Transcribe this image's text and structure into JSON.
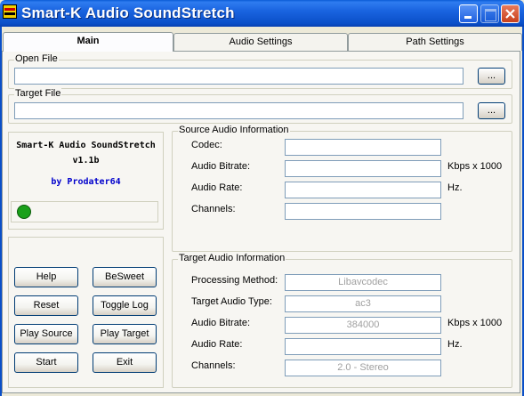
{
  "window": {
    "title": "Smart-K Audio SoundStretch"
  },
  "tabs": [
    {
      "label": "Main"
    },
    {
      "label": "Audio Settings"
    },
    {
      "label": "Path Settings"
    }
  ],
  "open_file": {
    "legend": "Open File",
    "value": "",
    "browse_label": "..."
  },
  "target_file": {
    "legend": "Target File",
    "value": "",
    "browse_label": "..."
  },
  "about": {
    "app_name": "Smart-K Audio SoundStretch",
    "version": "v1.1b",
    "author": "by Prodater64",
    "author_color": "#0000cc",
    "status_color": "#1aa01a"
  },
  "buttons": {
    "help": "Help",
    "besweet": "BeSweet",
    "reset": "Reset",
    "toggle_log": "Toggle Log",
    "play_source": "Play Source",
    "play_target": "Play Target",
    "start": "Start",
    "exit": "Exit"
  },
  "source_info": {
    "legend": "Source Audio Information",
    "codec_label": "Codec:",
    "codec_value": "",
    "bitrate_label": "Audio Bitrate:",
    "bitrate_value": "",
    "bitrate_unit": "Kbps x 1000",
    "rate_label": "Audio Rate:",
    "rate_value": "",
    "rate_unit": "Hz.",
    "channels_label": "Channels:",
    "channels_value": ""
  },
  "target_info": {
    "legend": "Target Audio Information",
    "method_label": "Processing Method:",
    "method_value": "Libavcodec",
    "type_label": "Target Audio Type:",
    "type_value": "ac3",
    "bitrate_label": "Audio Bitrate:",
    "bitrate_value": "384000",
    "bitrate_unit": "Kbps x 1000",
    "rate_label": "Audio Rate:",
    "rate_value": "",
    "rate_unit": "Hz.",
    "channels_label": "Channels:",
    "channels_value": "2.0 - Stereo"
  }
}
